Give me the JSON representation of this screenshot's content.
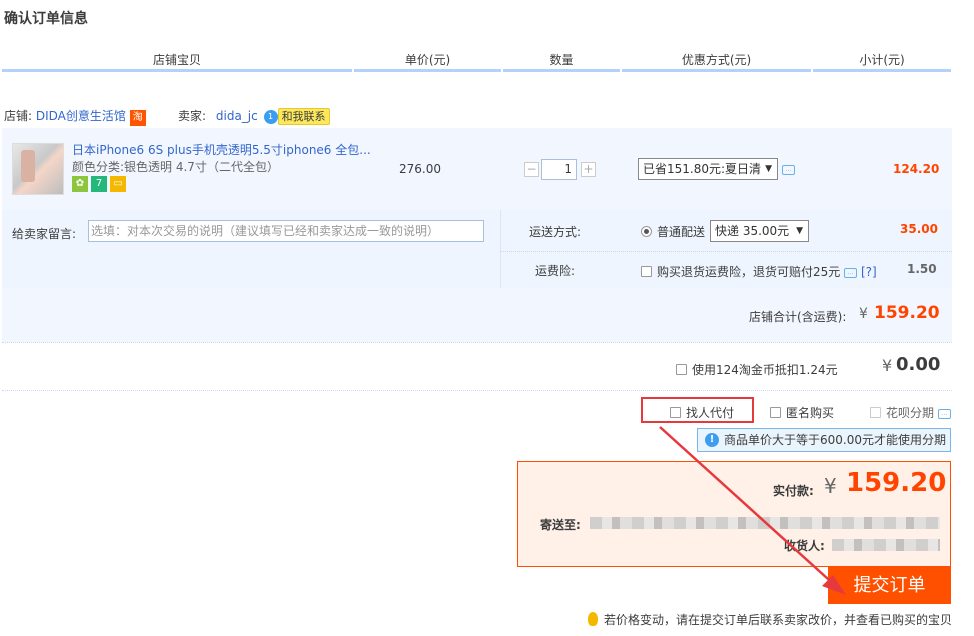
{
  "page": {
    "title": "确认订单信息"
  },
  "columns": {
    "item": "店铺宝贝",
    "unit_price": "单价(元)",
    "quantity": "数量",
    "discount": "优惠方式(元)",
    "subtotal": "小计(元)"
  },
  "shop": {
    "label": "店铺:",
    "name": "DIDA创意生活馆",
    "badge": "淘",
    "seller_label": "卖家:",
    "seller_name": "dida_jc",
    "contact_label": "和我联系"
  },
  "item": {
    "title": "日本iPhone6 6S plus手机壳透明5.5寸iphone6 全包...",
    "sku": "颜色分类:银色透明 4.7寸（二代全包）",
    "price": "276.00",
    "quantity": "1",
    "discount_option": "已省151.80元:夏日清",
    "subtotal": "124.20"
  },
  "message": {
    "label": "给卖家留言:",
    "placeholder": "选填：对本次交易的说明（建议填写已经和卖家达成一致的说明）"
  },
  "shipping": {
    "label": "运送方式:",
    "option": "普通配送",
    "select": "快递 35.00元",
    "cost": "35.00"
  },
  "insurance": {
    "label": "运费险:",
    "text": "购买退货运费险，退货可赔付25元",
    "help": "[?]",
    "cost": "1.50"
  },
  "shop_total": {
    "label": "店铺合计(含运费):",
    "currency": "¥",
    "amount": "159.20"
  },
  "coins": {
    "text": "使用124淘金币抵扣1.24元",
    "currency": "¥",
    "amount": "0.00"
  },
  "options": {
    "proxy": "找人代付",
    "anonymous": "匿名购买",
    "installment": "花呗分期"
  },
  "installment_notice": "商品单价大于等于600.00元才能使用分期",
  "payment": {
    "label": "实付款:",
    "currency": "¥",
    "amount": "159.20",
    "ship_to_label": "寄送至:",
    "receiver_label": "收货人:"
  },
  "submit": {
    "label": "提交订单"
  },
  "footer_tip": "若价格变动，请在提交订单后联系卖家改价，并查看已购买的宝贝",
  "colors": {
    "accent": "#ff5000",
    "price": "#ff4400",
    "link": "#3366cc",
    "highlight_box": "#e6393d"
  }
}
